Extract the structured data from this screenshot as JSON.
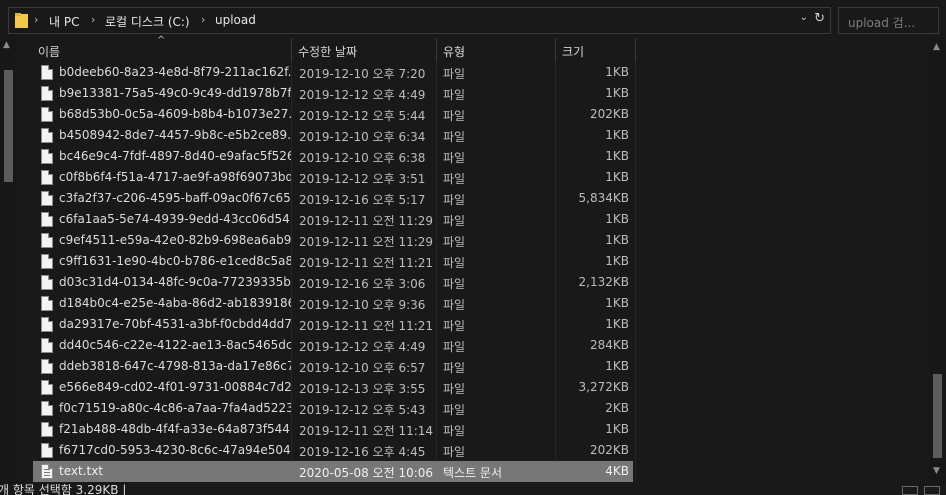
{
  "address": {
    "crumbs": [
      "내 PC",
      "로컬 디스크 (C:)",
      "upload"
    ],
    "separator": "›",
    "dropdown_glyph": "⌄",
    "refresh_glyph": "↻"
  },
  "search": {
    "placeholder": "upload 검..."
  },
  "columns": {
    "name": "이름",
    "date": "수정한 날짜",
    "type": "유형",
    "size": "크기"
  },
  "files": [
    {
      "name": "b0deeb60-8a23-4e8d-8f79-211ac162f...",
      "date": "2019-12-10 오후 7:20",
      "type": "파일",
      "size": "1KB"
    },
    {
      "name": "b9e13381-75a5-49c0-9c49-dd1978b7f...",
      "date": "2019-12-12 오후 4:49",
      "type": "파일",
      "size": "1KB"
    },
    {
      "name": "b68d53b0-0c5a-4609-b8b4-b1073e27...",
      "date": "2019-12-12 오후 5:44",
      "type": "파일",
      "size": "202KB"
    },
    {
      "name": "b4508942-8de7-4457-9b8c-e5b2ce89...",
      "date": "2019-12-10 오후 6:34",
      "type": "파일",
      "size": "1KB"
    },
    {
      "name": "bc46e9c4-7fdf-4897-8d40-e9afac5f526b",
      "date": "2019-12-10 오후 6:38",
      "type": "파일",
      "size": "1KB"
    },
    {
      "name": "c0f8b6f4-f51a-4717-ae9f-a98f69073bdd",
      "date": "2019-12-12 오후 3:51",
      "type": "파일",
      "size": "1KB"
    },
    {
      "name": "c3fa2f37-c206-4595-baff-09ac0f67c658",
      "date": "2019-12-16 오후 5:17",
      "type": "파일",
      "size": "5,834KB"
    },
    {
      "name": "c6fa1aa5-5e74-4939-9edd-43cc06d54...",
      "date": "2019-12-11 오전 11:29",
      "type": "파일",
      "size": "1KB"
    },
    {
      "name": "c9ef4511-e59a-42e0-82b9-698ea6ab9...",
      "date": "2019-12-11 오전 11:29",
      "type": "파일",
      "size": "1KB"
    },
    {
      "name": "c9ff1631-1e90-4bc0-b786-e1ced8c5a8...",
      "date": "2019-12-11 오전 11:21",
      "type": "파일",
      "size": "1KB"
    },
    {
      "name": "d03c31d4-0134-48fc-9c0a-77239335b...",
      "date": "2019-12-16 오후 3:06",
      "type": "파일",
      "size": "2,132KB"
    },
    {
      "name": "d184b0c4-e25e-4aba-86d2-ab1839186...",
      "date": "2019-12-10 오후 9:36",
      "type": "파일",
      "size": "1KB"
    },
    {
      "name": "da29317e-70bf-4531-a3bf-f0cbdd4dd7...",
      "date": "2019-12-11 오전 11:21",
      "type": "파일",
      "size": "1KB"
    },
    {
      "name": "dd40c546-c22e-4122-ae13-8ac5465dc...",
      "date": "2019-12-12 오후 4:49",
      "type": "파일",
      "size": "284KB"
    },
    {
      "name": "ddeb3818-647c-4798-813a-da17e86c7...",
      "date": "2019-12-10 오후 6:57",
      "type": "파일",
      "size": "1KB"
    },
    {
      "name": "e566e849-cd02-4f01-9731-00884c7d2...",
      "date": "2019-12-13 오후 3:55",
      "type": "파일",
      "size": "3,272KB"
    },
    {
      "name": "f0c71519-a80c-4c86-a7aa-7fa4ad5223...",
      "date": "2019-12-12 오후 5:43",
      "type": "파일",
      "size": "2KB"
    },
    {
      "name": "f21ab488-48db-4f4f-a33e-64a873f544...",
      "date": "2019-12-11 오전 11:14",
      "type": "파일",
      "size": "1KB"
    },
    {
      "name": "f6717cd0-5953-4230-8c6c-47a94e504...",
      "date": "2019-12-16 오후 4:45",
      "type": "파일",
      "size": "202KB"
    },
    {
      "name": "text.txt",
      "date": "2020-05-08 오전 10:06",
      "type": "텍스트 문서",
      "size": "4KB",
      "selected": true,
      "icon": "text-file-icon"
    }
  ],
  "status": {
    "text": "개 항목 선택함 3.29KB  |"
  },
  "icons": {
    "folder": "folder-icon",
    "file": "file-icon",
    "sort": "sort-up-icon"
  },
  "colors": {
    "background": "#191919",
    "selection": "#777777",
    "folder": "#f2c94c"
  }
}
